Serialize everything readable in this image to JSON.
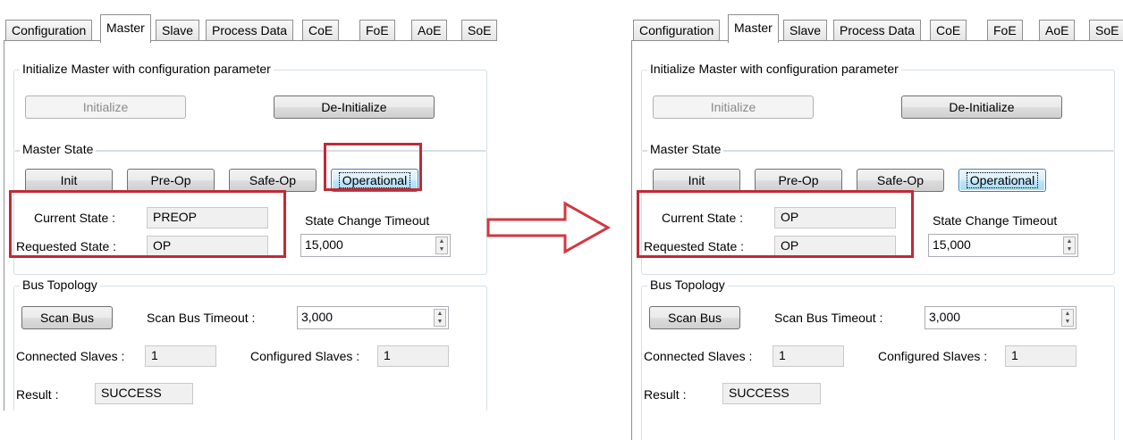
{
  "tabs": [
    "Configuration",
    "Master",
    "Slave",
    "Process Data",
    "CoE",
    "FoE",
    "AoE",
    "SoE"
  ],
  "init_group": {
    "title": "Initialize Master with configuration parameter",
    "initialize_label": "Initialize",
    "deinitialize_label": "De-Initialize"
  },
  "master_state": {
    "title": "Master State",
    "init_label": "Init",
    "preop_label": "Pre-Op",
    "safeop_label": "Safe-Op",
    "operational_label": "Operational",
    "current_state_label": "Current State :",
    "requested_state_label": "Requested State :",
    "state_change_timeout_label": "State Change Timeout",
    "state_change_timeout_value": "15,000"
  },
  "bus_topology": {
    "title": "Bus Topology",
    "scan_bus_label": "Scan Bus",
    "scan_bus_timeout_label": "Scan Bus Timeout :",
    "scan_bus_timeout_value": "3,000",
    "connected_slaves_label": "Connected Slaves :",
    "connected_slaves_value": "1",
    "configured_slaves_label": "Configured Slaves :",
    "configured_slaves_value": "1",
    "result_label": "Result :",
    "result_value": "SUCCESS"
  },
  "before": {
    "current_state": "PREOP",
    "requested_state": "OP"
  },
  "after": {
    "current_state": "OP",
    "requested_state": "OP"
  },
  "colors": {
    "highlight": "#c02a36",
    "arrow": "#d23741"
  },
  "icons": {
    "transition": "right-arrow-icon",
    "spinner": "spin-up-down-icon"
  }
}
